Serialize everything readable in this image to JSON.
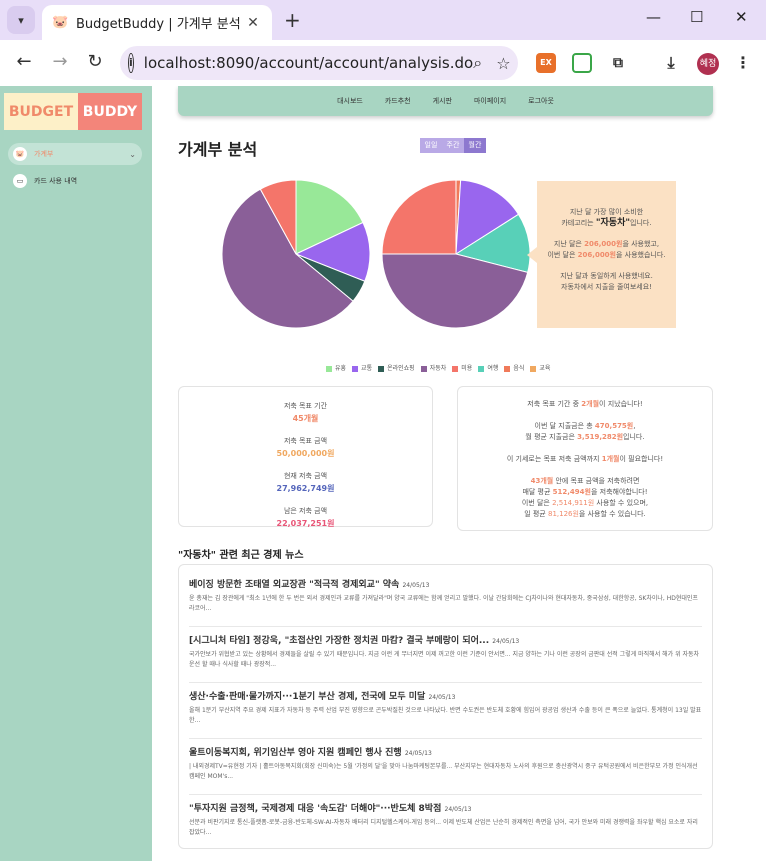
{
  "browser": {
    "tab_title": "BudgetBuddy | 가계부 분석",
    "url": "localhost:8090/account/account/analysis.do",
    "ext1": "EX",
    "profile": "혜정"
  },
  "sidebar": {
    "logo_left": "BUDGET",
    "logo_right": "BUDDY",
    "items": [
      {
        "label": "가계부"
      },
      {
        "label": "카드 사용 내역"
      }
    ]
  },
  "topnav": [
    "대시보드",
    "카드추천",
    "게시판",
    "마이페이지",
    "로그아웃"
  ],
  "header": {
    "title": "가계부 분석",
    "period": [
      "일일",
      "주간",
      "월간"
    ]
  },
  "bubble": {
    "l1": "지난 달 가장 많이 소비한",
    "l2a": "카테고리는 ",
    "l2b": "\"자동차\"",
    "l2c": "입니다.",
    "l3a": "지난 달은 ",
    "l3b": "206,000원",
    "l3c": "을 사용했고,",
    "l4a": "이번 달은 ",
    "l4b": "206,000원",
    "l4c": "을 사용했습니다.",
    "l5": "지난 달과 동일하게 사용했네요.",
    "l6": "자동차에서 지출을 줄여보세요!"
  },
  "legend": [
    {
      "name": "유흥",
      "color": "#98e898"
    },
    {
      "name": "교통",
      "color": "#9966ee"
    },
    {
      "name": "온라인쇼핑",
      "color": "#2f5d55"
    },
    {
      "name": "자동차",
      "color": "#8a5f98"
    },
    {
      "name": "미용",
      "color": "#f4756a"
    },
    {
      "name": "여행",
      "color": "#58d0b8"
    },
    {
      "name": "음식",
      "color": "#f07a5a"
    },
    {
      "name": "교육",
      "color": "#f0a860"
    }
  ],
  "chart_data": [
    {
      "type": "pie",
      "title": "",
      "categories": [
        "유흥",
        "교통",
        "온라인쇼핑",
        "자동차",
        "미용"
      ],
      "values": [
        18,
        13,
        5,
        56,
        8
      ]
    },
    {
      "type": "pie",
      "title": "",
      "categories": [
        "음식",
        "교통",
        "여행",
        "자동차",
        "미용"
      ],
      "values": [
        1,
        15,
        13,
        46,
        25
      ]
    }
  ],
  "goal_card": {
    "period_label": "저축 목표 기간",
    "period_value": "45개월",
    "amount_label": "저축 목표 금액",
    "amount_value": "50,000,000원",
    "current_label": "현재 저축 금액",
    "current_value": "27,962,749원",
    "remain_label": "남은 저축 금액",
    "remain_value": "22,037,251원"
  },
  "status_card": {
    "p1a": "저축 목표 기간 중 ",
    "p1b": "2개월",
    "p1c": "이 지났습니다!",
    "p2a": "이번 달 지출금은 총 ",
    "p2b": "470,575원",
    "p2c": ",",
    "p3a": "월 평균 지출금은 ",
    "p3b": "3,519,282원",
    "p3c": "입니다.",
    "p4a": "이 기세로는 목표 저축 금액까지 ",
    "p4b": "1개월",
    "p4c": "이 필요합니다!",
    "p5a": "43개월",
    "p5b": " 안에 목표 금액을 저축하려면",
    "p6a": "매달 평균 ",
    "p6b": "512,494원",
    "p6c": "을 저축해야합니다!",
    "p7a": "이번 달은 ",
    "p7b": "2,514,911원",
    "p7c": " 사용할 수 있으며,",
    "p8a": "일 평균 ",
    "p8b": "81,126원",
    "p8c": "을 사용할 수 있습니다."
  },
  "news": {
    "heading": "\"자동차\" 관련 최근 경제 뉴스",
    "items": [
      {
        "title": "베이징 방문한 조태열 외교장관 \"적극적 경제외교\" 약속",
        "date": "24/05/13",
        "summary": "윤 총재는 김 장관에게 \"최소 1년에 한 두 번은 외서 경제인과 교류를 가져달라\"며 양국 교류에는 함께 얻리고 말했다. 이날 간담회에는 CJ차이나와 현대자동차, 중국삼성, 대한항공, SK차이나, HD현대인프라코어..."
      },
      {
        "title": "[시그니처 타임] 정강욱, \"초접산인 가장한 정치권 마캄? 결국 부메랑이 되어...",
        "date": "24/05/13",
        "summary": "국가안보가 위협받고 있는 상황에서 경제들을 살릴 수 있기 때문입니다. 지금 이런 게 무너지면 이제 꺼고한 이런 기준이 안서면... 지금 양하는 기나 이런 공장의 금판대 선적 그렇게 마직해서 해가 위 자동차 운선 할 때나 식사할 때나 광장적..."
      },
      {
        "title": "생산·수출·판매·물가까지···1분기 부산 경제, 전국에 모두 미달",
        "date": "24/05/13",
        "summary": "올해 1분기 부산지역 주요 경제 지표가 자동차 등 주력 산업 부진 영향으로 곤두박질친 것으로 나타났다. 반면 수도권은 반도체 호황에 힘입어 광공업 생산과 수출 등이 큰 폭으로 늘었다. 통계청이 13일 발표한..."
      },
      {
        "title": "울트이동복지회, 위기임산부 영아 지원 캠페인 행사 진행",
        "date": "24/05/13",
        "summary": "| 내외경제TV=유현정 기자 | 홀트아동복지회(회장 신미숙)는 5월 '가정의 달'을 맞아 나눔마케팅본부를... 부산지부는 현대자동차 노사의 후원으로 충산광역시 중구 유턱공원에서 비은한부모 가정 인식개선 캠페인 MOM's..."
      },
      {
        "title": "\"투자지원 금정책, 국제경제 대응 '속도감' 더해야\"···반도체 8박점",
        "date": "24/05/13",
        "summary": "선분과 비판기지로 통신-플랫폼-로봇-금융-반도체-SW-AI-자동차 배터리 디지털헬스케어-게임 등의... 이제 반도체 산업은 난순히 경제적인 측면을 넘어, 국가 안보와 미래 경쟁력을 좌우할 핵심 요소로 자리 잡았다..."
      }
    ]
  }
}
